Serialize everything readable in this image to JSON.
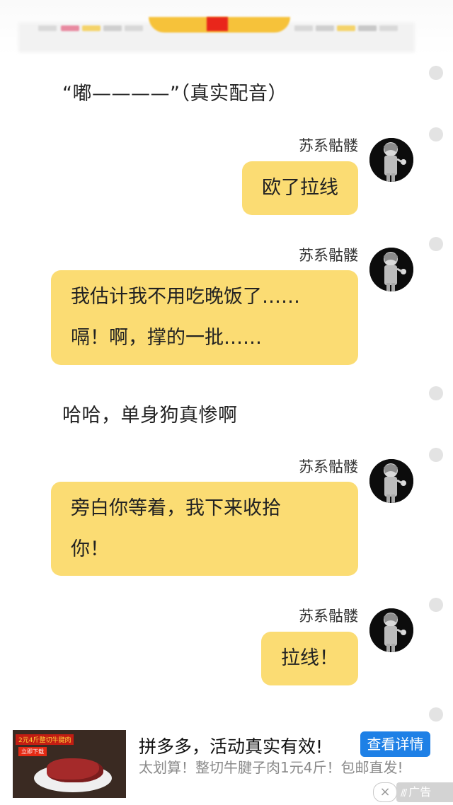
{
  "colors": {
    "bubble": "#fbdc73",
    "ad_button": "#1e80e6",
    "background": "#ffffff"
  },
  "messages": [
    {
      "kind": "narration",
      "text": "“嘟————”（真实配音）"
    },
    {
      "kind": "chat",
      "speaker": "苏系骷髅",
      "text": "欧了拉线"
    },
    {
      "kind": "chat",
      "speaker": "苏系骷髅",
      "lines": [
        "我估计我不用吃晚饭了……",
        "嗝！啊，撑的一批……"
      ]
    },
    {
      "kind": "narration",
      "text": "哈哈，单身狗真惨啊"
    },
    {
      "kind": "chat",
      "speaker": "苏系骷髅",
      "lines": [
        "旁白你等着，我下来收拾",
        "你！"
      ]
    },
    {
      "kind": "chat",
      "speaker": "苏系骷髅",
      "text": "拉线！"
    }
  ],
  "ad": {
    "thumb_banner": "2元4斤整切牛腱肉",
    "thumb_button": "立即下载",
    "title": "拼多多，活动真实有效!",
    "cta": "查看详情",
    "description": "太划算！整切牛腱子肉1元4斤！包邮直发!",
    "close_icon": "×",
    "label": "广告",
    "label_logo": "///"
  }
}
